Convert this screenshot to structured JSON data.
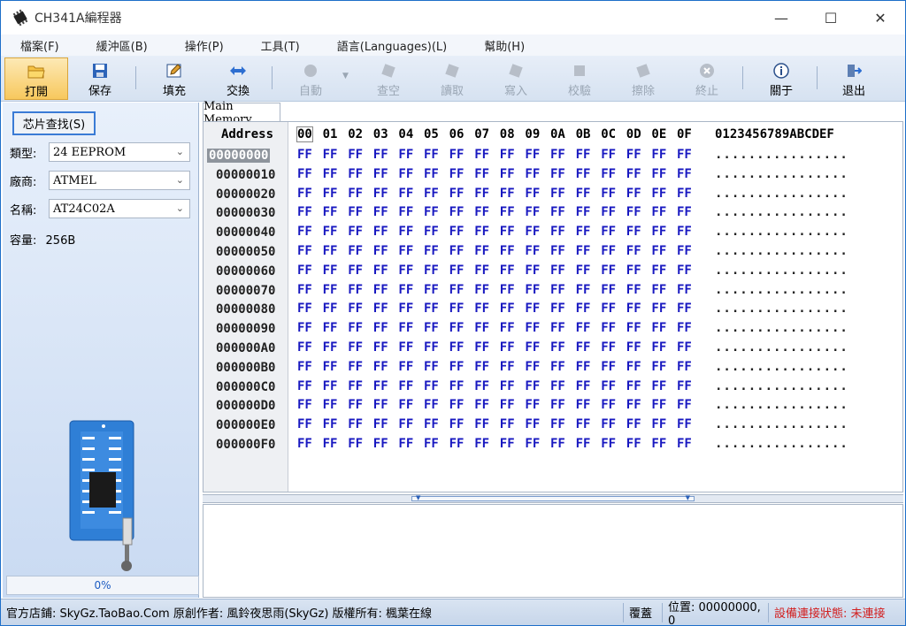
{
  "window": {
    "title": "CH341A編程器",
    "minimize": "—",
    "maximize": "☐",
    "close": "✕"
  },
  "menu": [
    "檔案(F)",
    "緩沖區(B)",
    "操作(P)",
    "工具(T)",
    "語言(Languages)(L)",
    "幫助(H)"
  ],
  "toolbar": {
    "open": "打開",
    "save": "保存",
    "fill": "填充",
    "swap": "交換",
    "auto": "自動",
    "blank": "查空",
    "read": "讀取",
    "write": "寫入",
    "verify": "校驗",
    "erase": "擦除",
    "stop": "終止",
    "about": "關于",
    "exit": "退出"
  },
  "left": {
    "find_button": "芯片查找(S)",
    "type_label": "類型:",
    "type_value": "24 EEPROM",
    "vendor_label": "廠商:",
    "vendor_value": "ATMEL",
    "name_label": "名稱:",
    "name_value": "AT24C02A",
    "capacity_label": "容量:",
    "capacity_value": "256B",
    "progress": "0%"
  },
  "hex": {
    "tab": "Main Memory",
    "address_header": "Address",
    "columns": [
      "00",
      "01",
      "02",
      "03",
      "04",
      "05",
      "06",
      "07",
      "08",
      "09",
      "0A",
      "0B",
      "0C",
      "0D",
      "0E",
      "0F"
    ],
    "ascii_header": "0123456789ABCDEF",
    "rows": [
      "00000000",
      "00000010",
      "00000020",
      "00000030",
      "00000040",
      "00000050",
      "00000060",
      "00000070",
      "00000080",
      "00000090",
      "000000A0",
      "000000B0",
      "000000C0",
      "000000D0",
      "000000E0",
      "000000F0"
    ],
    "byte_value": "FF",
    "ascii_row": "................"
  },
  "status": {
    "shop": "官方店鋪: SkyGz.TaoBao.Com  原創作者: 風鈴夜思雨(SkyGz)  版權所有: 楓葉在線",
    "mode": "覆蓋",
    "position": "位置: 00000000, 0",
    "device": "設備連接狀態: 未連接"
  },
  "colors": {
    "accent": "#1e6fc9",
    "byte_text": "#1818c0",
    "status_error": "#d21f1f"
  }
}
